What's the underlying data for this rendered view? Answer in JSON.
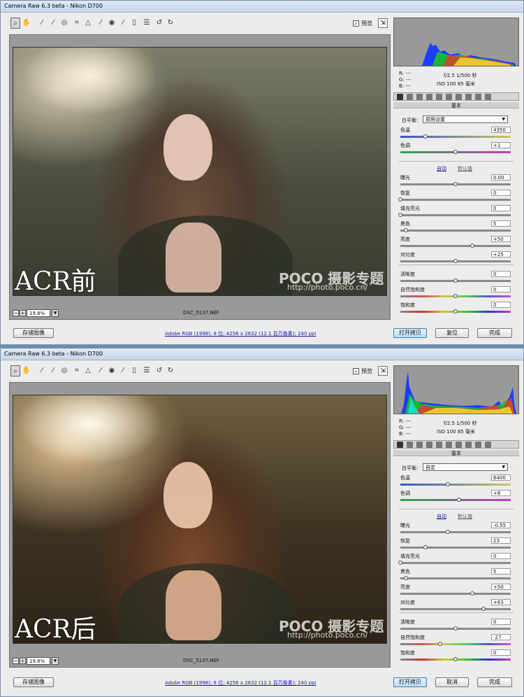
{
  "app": {
    "title": "Camera Raw 6.3 beta -  Nikon D700",
    "preview_label": "预览",
    "filename": "DSC_5137.NEF",
    "zoom": "19.8%",
    "info_link": "Adobe RGB (1998); 8 位; 4256 x 2832 (12.1 百万像素); 240 ppi",
    "save_label": "存储图像",
    "open_label": "打开拷贝",
    "done_label": "完成",
    "panel_title": "基本",
    "wb_label": "白平衡:",
    "auto_label": "自动",
    "default_label": "默认值",
    "rgb": {
      "r": "R:  ---",
      "g": "G:  ---",
      "b": "B:  ---"
    },
    "exif_line1": "f/2.5  1/500 秒",
    "exif_line2": "ISO 100  85 毫米",
    "watermark": "POCO 摄影专题",
    "watermark_url": "http://photo.poco.cn/"
  },
  "windows": [
    {
      "overlay": "ACR前",
      "reset_label": "复位",
      "wb_value": "原照设置",
      "sliders": [
        {
          "name": "色温",
          "value": "4350",
          "pos": 0.23,
          "kind": "temp"
        },
        {
          "name": "色调",
          "value": "+1",
          "pos": 0.5,
          "kind": "tint"
        },
        {
          "name": "曝光",
          "value": "0.00",
          "pos": 0.5,
          "kind": "gray"
        },
        {
          "name": "恢复",
          "value": "0",
          "pos": 0.0,
          "kind": "gray"
        },
        {
          "name": "填充亮光",
          "value": "0",
          "pos": 0.0,
          "kind": "gray"
        },
        {
          "name": "黑色",
          "value": "5",
          "pos": 0.05,
          "kind": "gray"
        },
        {
          "name": "亮度",
          "value": "+50",
          "pos": 0.65,
          "kind": "gray"
        },
        {
          "name": "对比度",
          "value": "+25",
          "pos": 0.5,
          "kind": "gray"
        },
        {
          "name": "清晰度",
          "value": "0",
          "pos": 0.5,
          "kind": "gray"
        },
        {
          "name": "自然饱和度",
          "value": "0",
          "pos": 0.5,
          "kind": "vib"
        },
        {
          "name": "饱和度",
          "value": "0",
          "pos": 0.5,
          "kind": "sat"
        }
      ]
    },
    {
      "overlay": "ACR后",
      "reset_label": "取消",
      "wb_value": "自定",
      "sliders": [
        {
          "name": "色温",
          "value": "6400",
          "pos": 0.43,
          "kind": "temp"
        },
        {
          "name": "色调",
          "value": "+8",
          "pos": 0.53,
          "kind": "tint"
        },
        {
          "name": "曝光",
          "value": "-0.55",
          "pos": 0.43,
          "kind": "gray"
        },
        {
          "name": "恢复",
          "value": "23",
          "pos": 0.23,
          "kind": "gray"
        },
        {
          "name": "填充亮光",
          "value": "0",
          "pos": 0.0,
          "kind": "gray"
        },
        {
          "name": "黑色",
          "value": "5",
          "pos": 0.05,
          "kind": "gray"
        },
        {
          "name": "亮度",
          "value": "+50",
          "pos": 0.65,
          "kind": "gray"
        },
        {
          "name": "对比度",
          "value": "+63",
          "pos": 0.75,
          "kind": "gray"
        },
        {
          "name": "清晰度",
          "value": "0",
          "pos": 0.5,
          "kind": "gray"
        },
        {
          "name": "自然饱和度",
          "value": "-27",
          "pos": 0.36,
          "kind": "vib"
        },
        {
          "name": "饱和度",
          "value": "0",
          "pos": 0.5,
          "kind": "sat"
        }
      ]
    }
  ],
  "toolbar_icons": [
    "zoom-icon",
    "hand-icon",
    "white-balance-icon",
    "color-sampler-icon",
    "target-adjust-icon",
    "crop-icon",
    "straighten-icon",
    "spot-removal-icon",
    "red-eye-icon",
    "adjustment-brush-icon",
    "graduated-filter-icon",
    "preferences-icon",
    "rotate-left-icon",
    "rotate-right-icon"
  ]
}
